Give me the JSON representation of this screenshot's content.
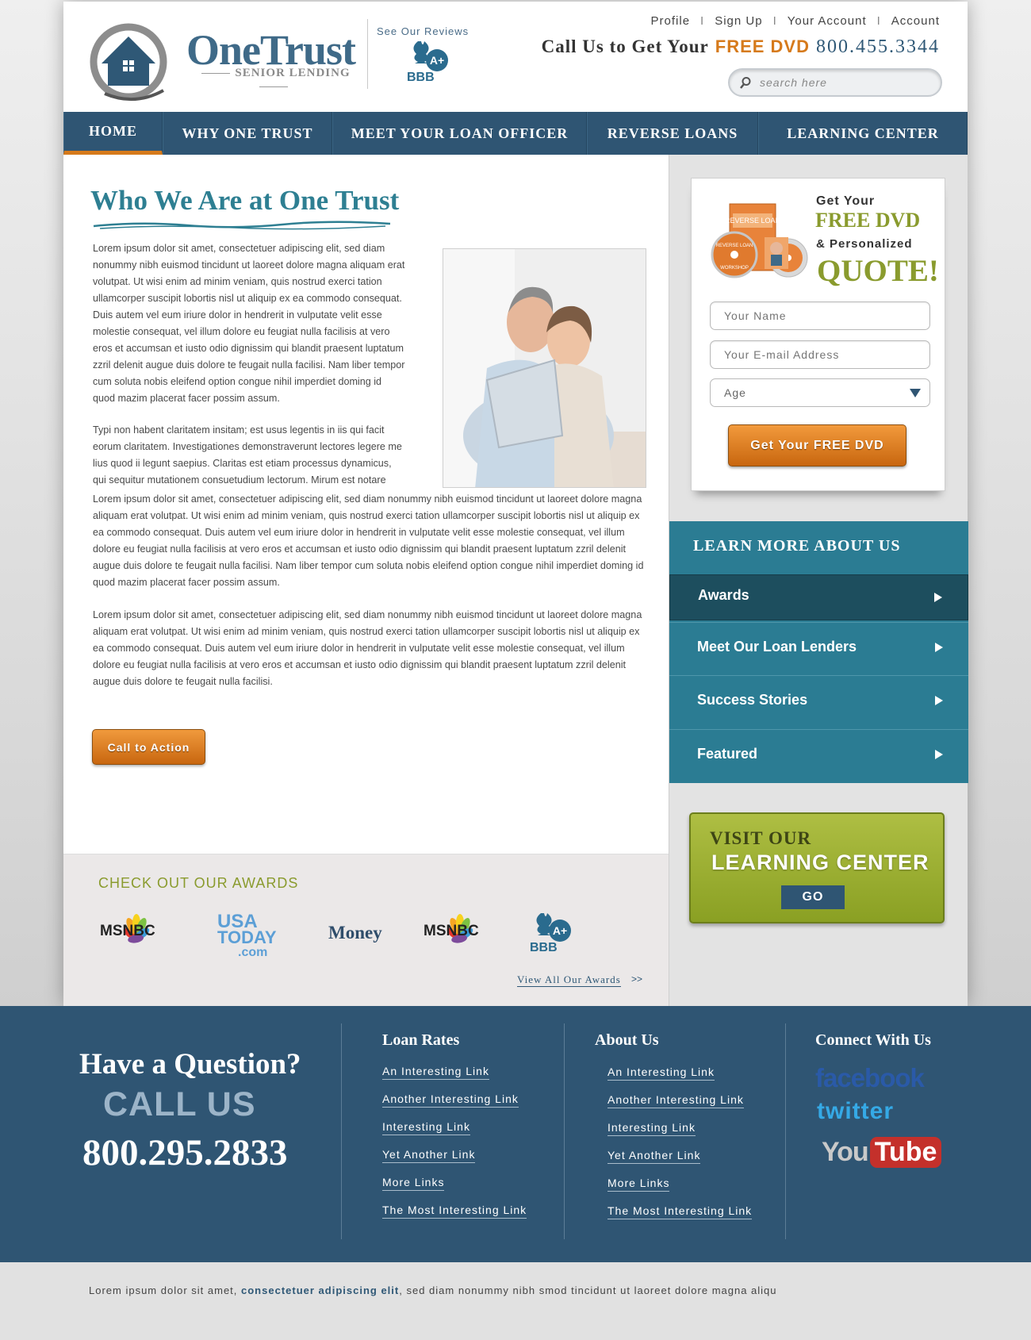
{
  "header": {
    "logo_name": "OneTrust",
    "logo_sub": "SENIOR LENDING",
    "reviews_label": "See Our Reviews",
    "bbb_grade": "A+",
    "bbb_text": "BBB",
    "top_links": [
      "Profile",
      "Sign Up",
      "Your Account",
      "Account"
    ],
    "top_link_separator": "I",
    "callus_text": "Call Us to Get Your",
    "callus_dvd": "FREE DVD",
    "callus_phone": "800.455.3344",
    "search_placeholder": "search here"
  },
  "nav": {
    "items": [
      "HOME",
      "WHY ONE TRUST",
      "MEET YOUR LOAN OFFICER",
      "REVERSE LOANS",
      "LEARNING CENTER"
    ],
    "active_index": 0
  },
  "main": {
    "title": "Who We Are at One Trust",
    "paragraphs": [
      "Lorem ipsum dolor sit amet, consectetuer adipiscing elit, sed diam nonummy nibh euismod tincidunt ut laoreet dolore magna aliquam erat volutpat. Ut wisi enim ad minim veniam, quis nostrud exerci tation ullamcorper suscipit lobortis nisl ut aliquip ex ea commodo consequat. Duis autem vel eum iriure dolor in hendrerit in vulputate velit esse molestie consequat, vel illum dolore eu feugiat nulla facilisis at vero eros et accumsan et iusto odio dignissim qui blandit praesent luptatum zzril delenit augue duis dolore te feugait nulla facilisi. Nam liber tempor cum soluta nobis eleifend option congue nihil imperdiet doming id quod mazim placerat facer possim assum.",
      "Typi non habent claritatem insitam; est usus legentis in iis qui facit eorum claritatem. Investigationes demonstraverunt lectores legere me lius quod ii legunt saepius. Claritas est etiam processus dynamicus, qui sequitur mutationem consuetudium lectorum. Mirum est notare quam littera",
      "Lorem ipsum dolor sit amet, consectetuer adipiscing elit, sed diam nonummy nibh euismod tincidunt ut laoreet dolore magna aliquam erat volutpat. Ut wisi enim ad minim veniam, quis nostrud exerci tation ullamcorper suscipit lobortis nisl ut aliquip ex ea commodo consequat. Duis autem vel eum iriure dolor in hendrerit in vulputate velit esse molestie consequat, vel illum dolore eu feugiat nulla facilisis at vero eros et accumsan et iusto odio dignissim qui blandit praesent luptatum zzril delenit augue duis dolore te feugait nulla facilisi. Nam liber tempor cum soluta nobis eleifend option congue nihil imperdiet doming id quod mazim placerat facer possim assum.",
      "Lorem ipsum dolor sit amet, consectetuer adipiscing elit, sed diam nonummy nibh euismod tincidunt ut laoreet dolore magna aliquam erat volutpat. Ut wisi enim ad minim veniam, quis nostrud exerci tation ullamcorper suscipit lobortis nisl ut aliquip ex ea commodo consequat. Duis autem vel eum iriure dolor in hendrerit in vulputate velit esse molestie consequat, vel illum dolore eu feugiat nulla facilisis at vero eros et accumsan et iusto odio dignissim qui blandit praesent luptatum zzril delenit augue duis dolore te feugait nulla facilisi."
    ],
    "cta_label": "Call to Action"
  },
  "awards": {
    "title": "CHECK OUT OUR AWARDS",
    "logos": {
      "msnbc": "MSNBC",
      "usa": "USA",
      "today": "TODAY",
      "com": ".com",
      "money": "Money"
    },
    "view_all_label": "View All Our Awards",
    "view_all_arrows": ">>"
  },
  "quote_form": {
    "get_your": "Get Your",
    "free_dvd": "FREE DVD",
    "personalized": "& Personalized",
    "quote": "QUOTE!",
    "dvd_case_text": "REVERSE LOAN",
    "disc_text": "REVERSE LOAN",
    "disc_label": "WORKSHOP",
    "name_placeholder": "Your Name",
    "email_placeholder": "Your E-mail Address",
    "age_value": "Age",
    "submit_label": "Get Your FREE DVD"
  },
  "learn_more": {
    "title": "LEARN MORE ABOUT US",
    "items": [
      "Awards",
      "Meet Our Loan Lenders",
      "Success Stories",
      "Featured"
    ],
    "active_index": 0
  },
  "learning_center": {
    "visit": "VISIT OUR",
    "center": "LEARNING CENTER",
    "go_label": "GO"
  },
  "footer": {
    "question": "Have a Question?",
    "call_us": "CALL US",
    "phone": "800.295.2833",
    "loan_rates": {
      "title": "Loan Rates",
      "links": [
        "An Interesting Link",
        "Another Interesting Link",
        "Interesting Link",
        "Yet Another Link",
        "More Links",
        "The Most Interesting Link"
      ]
    },
    "about_us": {
      "title": "About Us",
      "links": [
        "An Interesting Link",
        "Another Interesting Link",
        "Interesting Link",
        "Yet Another Link",
        "More Links",
        "The Most Interesting Link"
      ]
    },
    "connect": {
      "title": "Connect With Us",
      "facebook": "facebook",
      "twitter": "twitter",
      "you": "You",
      "tube": "Tube"
    }
  },
  "bottom_bar": {
    "text_before": "Lorem ipsum dolor sit amet, ",
    "text_strong": "consectetuer adipiscing elit",
    "text_after": ", sed diam nonummy nibh smod tincidunt ut laoreet dolore magna aliqu"
  },
  "colors": {
    "brand_blue": "#2f5573",
    "accent_orange": "#d67a1b",
    "accent_green": "#8a9b2e",
    "teal": "#2b7c93"
  }
}
